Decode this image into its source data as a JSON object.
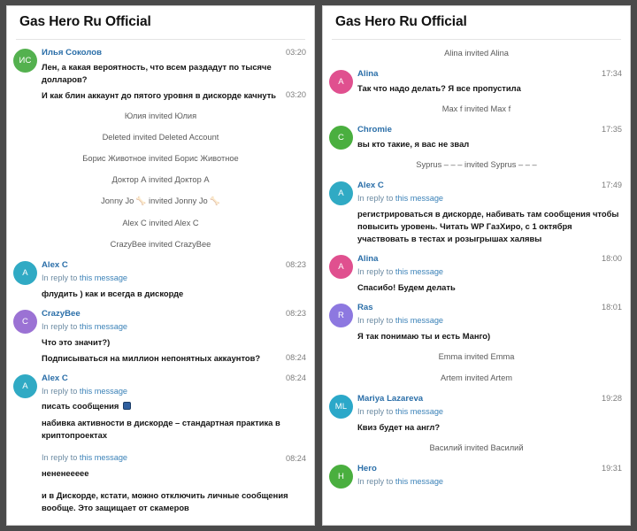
{
  "window": {
    "background_color": "#4a4a4a",
    "panel_background": "#ffffff"
  },
  "panels": [
    {
      "id": "left-panel",
      "header": {
        "title": "Gas Hero Ru Official"
      },
      "items": [
        {
          "kind": "message",
          "avatar": {
            "initials": "ИС",
            "color": "#54b14f"
          },
          "sender": "Илья Соколов",
          "time": "03:20",
          "lines": [
            {
              "text": "Лен, а какая вероятность, что всем раздадут по тысяче долларов?"
            }
          ],
          "extra_rows": [
            {
              "text": "И как блин аккаунт до пятого уровня в дискорде качнуть",
              "time": "03:20"
            }
          ]
        },
        {
          "kind": "system",
          "text": "Юлия invited Юлия"
        },
        {
          "kind": "system",
          "text": "Deleted invited Deleted Account"
        },
        {
          "kind": "system",
          "text": "Борис Животное invited Борис Животное"
        },
        {
          "kind": "system",
          "text": "Доктор А invited Доктор А"
        },
        {
          "kind": "system",
          "text": "Jonny Jo 🦴 invited Jonny Jo 🦴"
        },
        {
          "kind": "system",
          "text": "Alex C invited Alex C"
        },
        {
          "kind": "system",
          "text": "CrazyBee invited CrazyBee"
        },
        {
          "kind": "message",
          "avatar": {
            "initials": "A",
            "color": "#30aac4"
          },
          "sender": "Alex C",
          "time": "08:23",
          "reply": {
            "prefix": "In reply to ",
            "link": "this message"
          },
          "lines": [
            {
              "text": "флудить ) как и всегда в дискорде"
            }
          ],
          "extra_rows": []
        },
        {
          "kind": "message",
          "avatar": {
            "initials": "C",
            "color": "#9b72d4"
          },
          "sender": "CrazyBee",
          "time": "08:23",
          "reply": {
            "prefix": "In reply to ",
            "link": "this message"
          },
          "lines": [
            {
              "text": "Что это значит?)"
            }
          ],
          "extra_rows": [
            {
              "text": "Подписываться на миллион непонятных аккаунтов?",
              "time": "08:24"
            }
          ]
        },
        {
          "kind": "message",
          "avatar": {
            "initials": "A",
            "color": "#30aac4"
          },
          "sender": "Alex C",
          "time": "08:24",
          "reply": {
            "prefix": "In reply to ",
            "link": "this message"
          },
          "lines": [
            {
              "text": "писать сообщения ",
              "emoji": true
            },
            {
              "text": "набивка активности в дискорде – стандартная практика в криптопроектах"
            }
          ],
          "extra_rows": [],
          "trailing_reply": {
            "prefix": "In reply to ",
            "link": "this message",
            "time": "08:24"
          },
          "trailing_lines": [
            {
              "text": "нененеееее"
            },
            {
              "text": ""
            },
            {
              "text": "и в Дискорде, кстати, можно отключить личные сообщения вообще. Это защищает от скамеров"
            }
          ]
        }
      ]
    },
    {
      "id": "right-panel",
      "header": {
        "title": "Gas Hero Ru Official"
      },
      "items": [
        {
          "kind": "system",
          "text": "Alina invited Alina"
        },
        {
          "kind": "message",
          "avatar": {
            "initials": "A",
            "color": "#e0508f"
          },
          "sender": "Alina",
          "time": "17:34",
          "lines": [
            {
              "text": "Так что надо делать? Я все пропустила"
            }
          ],
          "extra_rows": []
        },
        {
          "kind": "system",
          "text": "Max f invited Max f"
        },
        {
          "kind": "message",
          "avatar": {
            "initials": "C",
            "color": "#4aaf3f"
          },
          "sender": "Chromie",
          "time": "17:35",
          "lines": [
            {
              "text": "вы кто такие, я вас не звал"
            }
          ],
          "extra_rows": []
        },
        {
          "kind": "system",
          "text": "Syprus – – – invited Syprus – – –"
        },
        {
          "kind": "message",
          "avatar": {
            "initials": "A",
            "color": "#30aac4"
          },
          "sender": "Alex C",
          "time": "17:49",
          "reply": {
            "prefix": "In reply to ",
            "link": "this message"
          },
          "lines": [
            {
              "text": "регистрироваться в дискорде, набивать там сообщения чтобы повысить уровень. Читать WP ГазХиро, с 1 октября участвовать в тестах и розыгрышах халявы"
            }
          ],
          "extra_rows": []
        },
        {
          "kind": "message",
          "avatar": {
            "initials": "A",
            "color": "#e0508f"
          },
          "sender": "Alina",
          "time": "18:00",
          "reply": {
            "prefix": "In reply to ",
            "link": "this message"
          },
          "lines": [
            {
              "text": "Спасибо! Будем делать"
            }
          ],
          "extra_rows": []
        },
        {
          "kind": "message",
          "avatar": {
            "initials": "R",
            "color": "#8d78e0"
          },
          "sender": "Ras",
          "time": "18:01",
          "reply": {
            "prefix": "In reply to ",
            "link": "this message"
          },
          "lines": [
            {
              "text": "Я так понимаю ты и есть Манго)"
            }
          ],
          "extra_rows": []
        },
        {
          "kind": "system",
          "text": "Emma invited Emma"
        },
        {
          "kind": "system",
          "text": "Artem invited Artem"
        },
        {
          "kind": "message",
          "avatar": {
            "initials": "ML",
            "color": "#2ba8c9"
          },
          "sender": "Mariya Lazareva",
          "time": "19:28",
          "reply": {
            "prefix": "In reply to ",
            "link": "this message"
          },
          "lines": [
            {
              "text": "Квиз будет на англ?"
            }
          ],
          "extra_rows": []
        },
        {
          "kind": "system",
          "text": "Василий invited Василий"
        },
        {
          "kind": "message",
          "avatar": {
            "initials": "H",
            "color": "#4aaf3f"
          },
          "sender": "Hero",
          "time": "19:31",
          "reply": {
            "prefix": "In reply to ",
            "link": "this message"
          },
          "lines": [],
          "extra_rows": []
        }
      ]
    }
  ]
}
